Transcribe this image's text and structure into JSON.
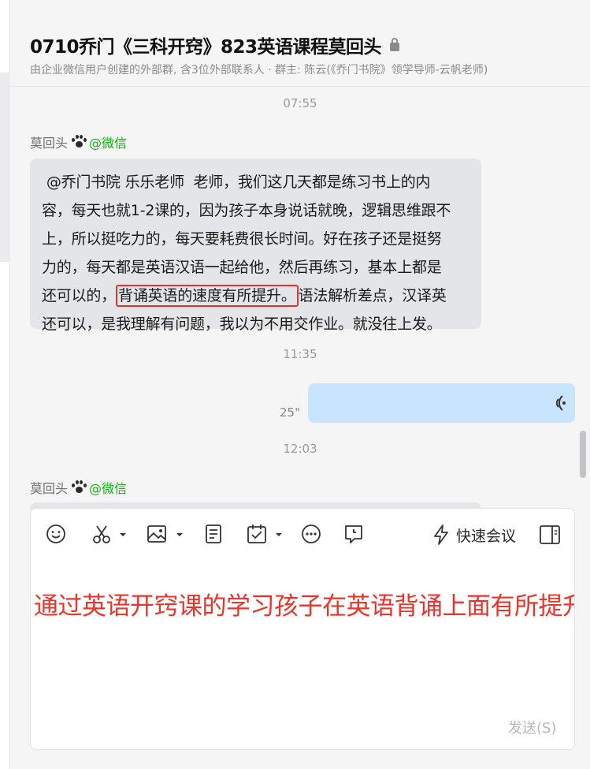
{
  "header": {
    "title": "0710乔门《三科开窍》823英语课程莫回头",
    "subtitle": "由企业微信用户创建的外部群, 含3位外部联系人 · 群主: 陈云(《乔门书院》领学导师-云帆老师)"
  },
  "messages": {
    "time1": "07:55",
    "sender1": {
      "name": "莫回头",
      "tag": "@微信",
      "icon": "paw-icon"
    },
    "message1": {
      "line1": " @乔门书院 乐乐老师  老师，我们这几天都是练习书上的内",
      "line2": "容，每天也就1-2课的，因为孩子本身说话就晚，逻辑思维跟不",
      "line3": "上，所以挺吃力的，每天要耗费很长时间。好在孩子还是挺努",
      "line4": "力的，每天都是英语汉语一起给他，然后再练习，基本上都是",
      "line5_pre": "还可以的，",
      "line5_highlight": "背诵英语的速度有所提升。",
      "line5_post": "语法解析差点，汉译英",
      "line6": "还可以，是我理解有问题，我以为不用交作业。就没往上发。"
    },
    "time2": "11:35",
    "voice": {
      "duration": "25\"",
      "icon": "voice-wave-icon"
    },
    "time3": "12:03",
    "sender2": {
      "name": "莫回头",
      "tag": "@微信"
    }
  },
  "composer": {
    "toolbar": {
      "meeting_label": "快速会议",
      "icons": [
        "emoji-icon",
        "scissors-icon",
        "image-icon",
        "file-icon",
        "calendar-check-icon",
        "more-icon",
        "chat-record-icon",
        "lightning-icon",
        "side-panel-icon"
      ]
    },
    "text": "通过英语开窍课的学习孩子在英语背诵上面有所提升",
    "send_label": "发送(S)"
  },
  "colors": {
    "accent_wechat": "#1aad19",
    "highlight_box": "#e0342e",
    "composer_text": "#e8352c",
    "outgoing_bubble": "#c9e4ff",
    "incoming_bubble": "#e4e5e8"
  }
}
